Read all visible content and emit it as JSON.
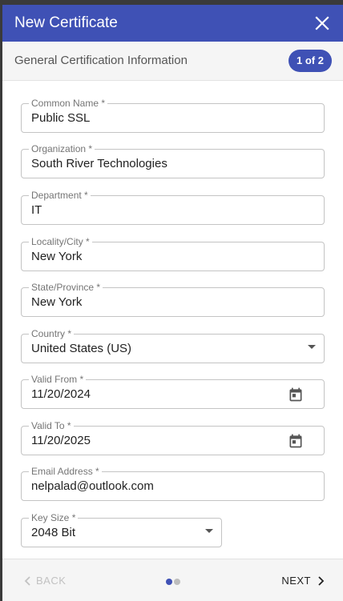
{
  "dialog": {
    "title": "New Certificate",
    "subtitle": "General Certification Information",
    "step_badge": "1 of 2"
  },
  "fields": {
    "common_name": {
      "label": "Common Name *",
      "value": "Public SSL"
    },
    "organization": {
      "label": "Organization *",
      "value": "South River Technologies"
    },
    "department": {
      "label": "Department *",
      "value": "IT"
    },
    "locality": {
      "label": "Locality/City *",
      "value": "New York"
    },
    "state": {
      "label": "State/Province *",
      "value": "New York"
    },
    "country": {
      "label": "Country *",
      "value": "United States (US)"
    },
    "valid_from": {
      "label": "Valid From *",
      "value": "11/20/2024"
    },
    "valid_to": {
      "label": "Valid To *",
      "value": "11/20/2025"
    },
    "email": {
      "label": "Email Address *",
      "value": "nelpalad@outlook.com"
    },
    "key_size": {
      "label": "Key Size *",
      "value": "2048 Bit"
    }
  },
  "footer": {
    "back_label": "BACK",
    "next_label": "NEXT",
    "total_steps": 2,
    "current_step": 1
  },
  "icons": {
    "close": "close-icon",
    "dropdown": "caret-down-icon",
    "calendar": "calendar-icon",
    "back": "chevron-left-icon",
    "next": "chevron-right-icon"
  },
  "colors": {
    "primary": "#3f51b5",
    "dot_active": "#3f51b5",
    "dot_inactive": "#bdbdbd",
    "disabled_text": "#c2c2c2"
  }
}
